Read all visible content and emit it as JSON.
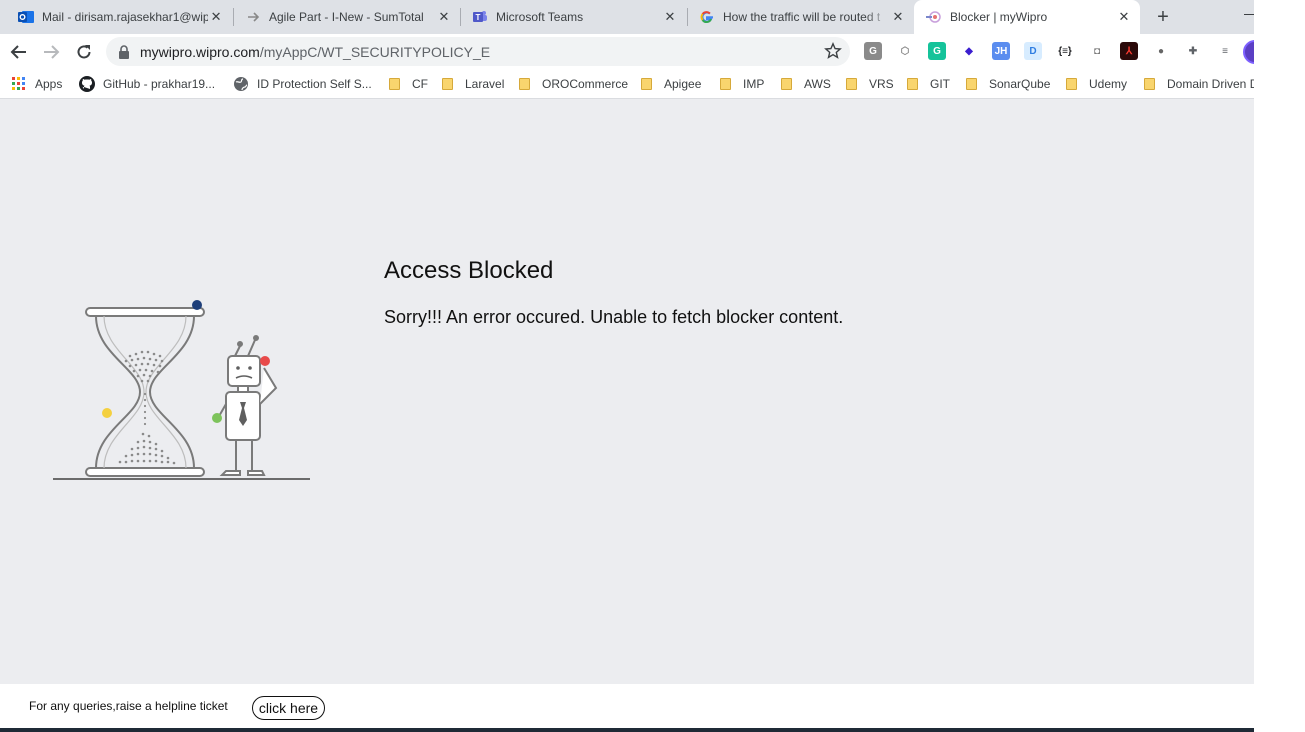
{
  "browser": {
    "tabs": [
      {
        "title": "Mail - dirisam.rajasekhar1@wip",
        "icon": "outlook-icon",
        "active": false
      },
      {
        "title": "Agile Part - I-New - SumTotal",
        "icon": "sumtotal-icon",
        "active": false
      },
      {
        "title": "Microsoft Teams",
        "icon": "teams-icon",
        "active": false
      },
      {
        "title": "How the traffic will be routed t",
        "icon": "google-icon",
        "active": false
      },
      {
        "title": "Blocker | myWipro",
        "icon": "wipro-icon",
        "active": true
      }
    ],
    "url": {
      "host": "mywipro.wipro.com",
      "path": "/myAppC/WT_SECURITYPOLICY_E"
    },
    "bookmarks": [
      {
        "label": "Apps",
        "icon": "apps-grid-icon"
      },
      {
        "label": "GitHub - prakhar19...",
        "icon": "github-icon"
      },
      {
        "label": "ID Protection Self S...",
        "icon": "globe-icon"
      },
      {
        "label": "CF",
        "icon": "folder-icon"
      },
      {
        "label": "Laravel",
        "icon": "folder-icon"
      },
      {
        "label": "OROCommerce",
        "icon": "folder-icon"
      },
      {
        "label": "Apigee",
        "icon": "folder-icon"
      },
      {
        "label": "IMP",
        "icon": "folder-icon"
      },
      {
        "label": "AWS",
        "icon": "folder-icon"
      },
      {
        "label": "VRS",
        "icon": "folder-icon"
      },
      {
        "label": "GIT",
        "icon": "folder-icon"
      },
      {
        "label": "SonarQube",
        "icon": "folder-icon"
      },
      {
        "label": "Udemy",
        "icon": "folder-icon"
      },
      {
        "label": "Domain Driven D",
        "icon": "folder-icon"
      }
    ],
    "extensions": [
      {
        "name": "g-extension-icon",
        "glyph": "G",
        "color": "#8a8a8a",
        "fg": "#ffffff"
      },
      {
        "name": "hexagon-extension-icon",
        "glyph": "⬡",
        "color": "transparent",
        "fg": "#8a8a8a"
      },
      {
        "name": "grammarly-icon",
        "glyph": "G",
        "color": "#15c39a",
        "fg": "#ffffff"
      },
      {
        "name": "layers-extension-icon",
        "glyph": "◆",
        "color": "transparent",
        "fg": "#3b1ecf"
      },
      {
        "name": "jh-extension-icon",
        "glyph": "JH",
        "color": "#5b8def",
        "fg": "#ffffff"
      },
      {
        "name": "d-extension-icon",
        "glyph": "D",
        "color": "#d7ecff",
        "fg": "#2f7de1"
      },
      {
        "name": "json-formatter-icon",
        "glyph": "{≡}",
        "color": "transparent",
        "fg": "#202124"
      },
      {
        "name": "camera-icon",
        "glyph": "◘",
        "color": "transparent",
        "fg": "#7a7a7a"
      },
      {
        "name": "acrobat-icon",
        "glyph": "⅄",
        "color": "#2b0a0a",
        "fg": "#ff3b30"
      },
      {
        "name": "circle-extension-icon",
        "glyph": "●",
        "color": "transparent",
        "fg": "#666666"
      },
      {
        "name": "puzzle-icon",
        "glyph": "✚",
        "color": "transparent",
        "fg": "#5f6368"
      },
      {
        "name": "media-queue-icon",
        "glyph": "≡",
        "color": "transparent",
        "fg": "#5f6368"
      }
    ]
  },
  "page": {
    "heading": "Access Blocked",
    "message": "Sorry!!! An error occured. Unable to fetch blocker content."
  },
  "footer": {
    "text": "For any queries,raise a helpline ticket",
    "button_label": "click here"
  }
}
